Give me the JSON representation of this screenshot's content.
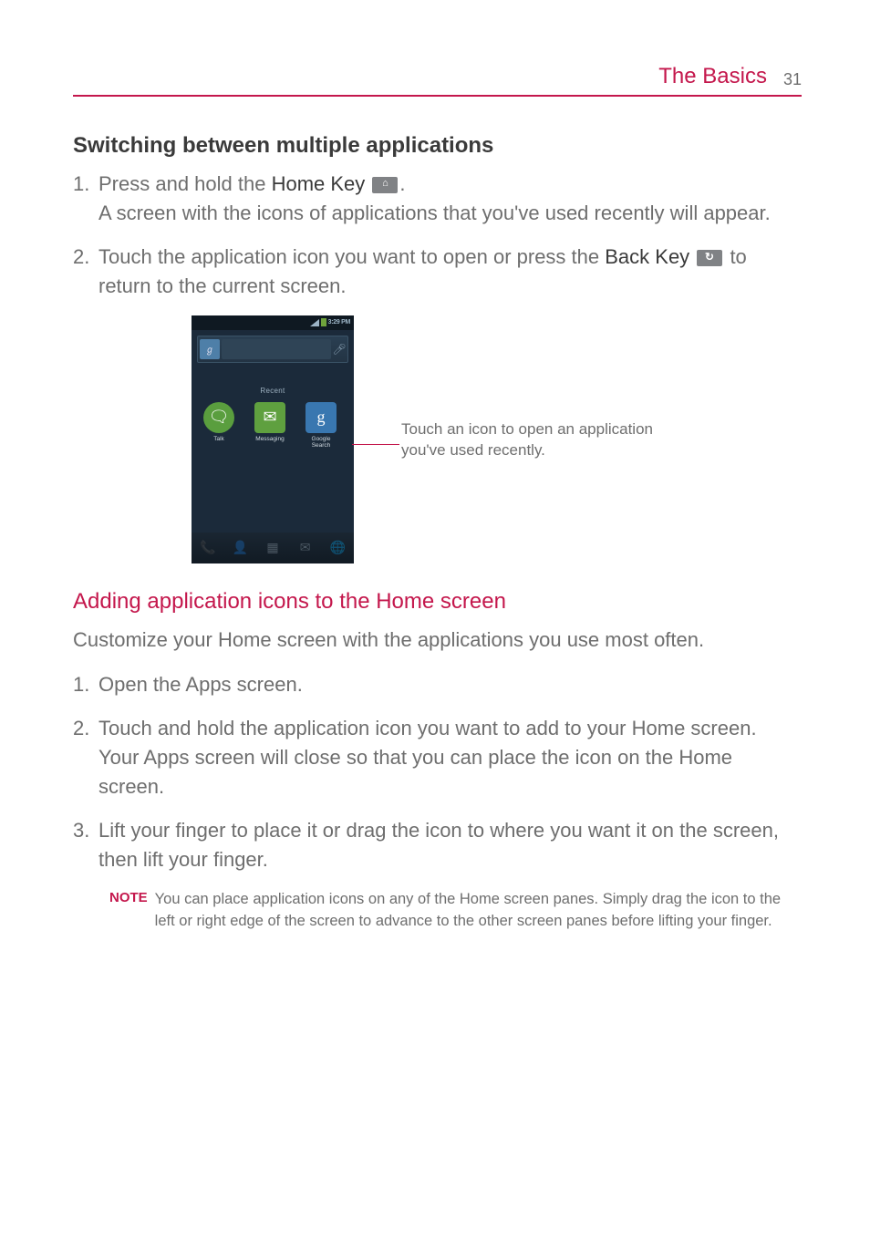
{
  "header": {
    "section": "The Basics",
    "page_number": "31"
  },
  "heading_switching": "Switching between multiple applications",
  "steps_switching": [
    {
      "prefix": "Press and hold the ",
      "key_name": "Home Key",
      "suffix": ".",
      "line2": "A screen with the icons of applications that you've used recently will appear."
    },
    {
      "prefix": "Touch the application icon you want to open or press the ",
      "key_name": "Back Key",
      "suffix": "",
      "line2": "to return to the current screen."
    }
  ],
  "phone": {
    "time": "3:29 PM",
    "recent_label": "Recent",
    "apps": [
      {
        "glyph": "talk",
        "label": "Talk"
      },
      {
        "glyph": "✉",
        "label": "Messaging"
      },
      {
        "glyph": "g",
        "label": "Google\nSearch"
      }
    ]
  },
  "callout": "Touch an icon to open an application you've used recently.",
  "heading_adding": "Adding application icons to the Home screen",
  "intro_adding": "Customize your Home screen with the applications you use most often.",
  "steps_adding": [
    "Open the Apps screen.",
    "Touch and hold the application icon you want to add to your Home screen. Your Apps screen will close so that you can place the icon on the Home screen.",
    "Lift your finger to place it or drag the icon to where you want it on the screen, then lift your finger."
  ],
  "note": {
    "label": "NOTE",
    "text": "You can place application icons on any of the Home screen panes.  Simply drag the icon to the left or right edge of the screen to advance to the other screen panes before lifting your finger."
  }
}
